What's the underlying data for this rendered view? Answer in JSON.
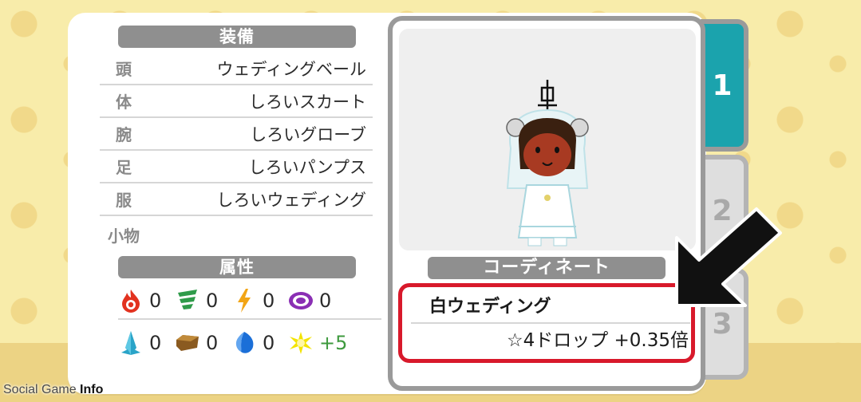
{
  "equipment": {
    "header": "装備",
    "rows": [
      {
        "slot": "頭",
        "item": "ウェディングベール"
      },
      {
        "slot": "体",
        "item": "しろいスカート"
      },
      {
        "slot": "腕",
        "item": "しろいグローブ"
      },
      {
        "slot": "足",
        "item": "しろいパンプス"
      },
      {
        "slot": "服",
        "item": "しろいウェディング"
      },
      {
        "slot": "小物",
        "item": ""
      }
    ]
  },
  "attributes": {
    "header": "属性",
    "row1": [
      {
        "icon": "fire-icon",
        "value": "0"
      },
      {
        "icon": "wind-icon",
        "value": "0"
      },
      {
        "icon": "lightning-icon",
        "value": "0"
      },
      {
        "icon": "dark-swirl-icon",
        "value": "0"
      }
    ],
    "row2": [
      {
        "icon": "ice-crystal-icon",
        "value": "0"
      },
      {
        "icon": "earth-icon",
        "value": "0"
      },
      {
        "icon": "water-drop-icon",
        "value": "0"
      },
      {
        "icon": "light-burst-icon",
        "value": "+5"
      }
    ],
    "colors": {
      "bonus": "#3e9a3e"
    }
  },
  "coordinate": {
    "header": "コーディネート",
    "name": "白ウェディング",
    "bonus": "☆4ドロップ +0.35倍"
  },
  "tabs": [
    "1",
    "2",
    "3"
  ],
  "watermark": {
    "part1": "Social Game ",
    "part2": "Info"
  },
  "colors": {
    "accent": "#1ba3ad",
    "highlight": "#d8192b",
    "pill": "#8f8f8f"
  }
}
